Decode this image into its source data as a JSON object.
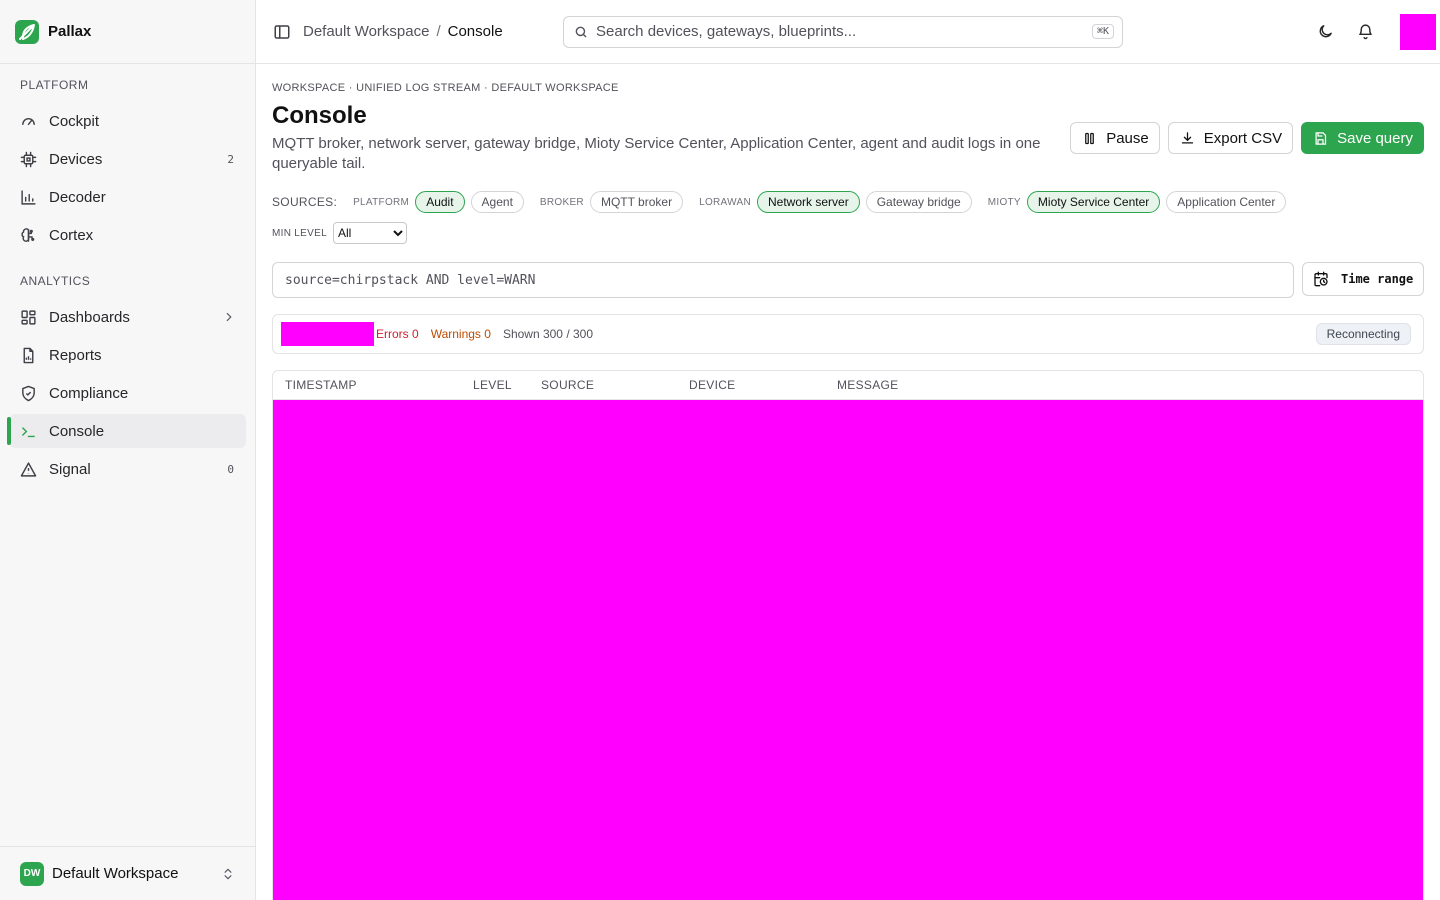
{
  "app": {
    "name": "Pallax"
  },
  "sidebar": {
    "sections": [
      {
        "label": "PLATFORM"
      },
      {
        "label": "ANALYTICS"
      }
    ],
    "items": [
      {
        "label": "Cockpit",
        "badge": ""
      },
      {
        "label": "Devices",
        "badge": "2"
      },
      {
        "label": "Decoder",
        "badge": ""
      },
      {
        "label": "Cortex",
        "badge": ""
      },
      {
        "label": "Dashboards",
        "badge": ""
      },
      {
        "label": "Reports",
        "badge": ""
      },
      {
        "label": "Compliance",
        "badge": ""
      },
      {
        "label": "Console",
        "badge": ""
      },
      {
        "label": "Signal",
        "badge": "0"
      }
    ],
    "active_item": "Console",
    "workspace": {
      "initials": "DW",
      "name": "Default Workspace"
    }
  },
  "header": {
    "breadcrumb": {
      "workspace": "Default Workspace",
      "separator": "/",
      "current": "Console"
    },
    "search": {
      "placeholder": "Search devices, gateways, blueprints...",
      "shortcut": "⌘K"
    }
  },
  "page": {
    "eyebrow": "WORKSPACE · UNIFIED LOG STREAM · DEFAULT WORKSPACE",
    "title": "Console",
    "description": "MQTT broker, network server, gateway bridge, Mioty Service Center, Application Center, agent and audit logs in one queryable tail.",
    "actions": {
      "pause": "Pause",
      "export": "Export CSV",
      "save": "Save query"
    }
  },
  "sources": {
    "label": "SOURCES:",
    "groups": [
      {
        "name": "PLATFORM",
        "chips": [
          {
            "label": "Audit",
            "on": true
          },
          {
            "label": "Agent",
            "on": false
          }
        ]
      },
      {
        "name": "BROKER",
        "chips": [
          {
            "label": "MQTT broker",
            "on": false
          }
        ]
      },
      {
        "name": "LORAWAN",
        "chips": [
          {
            "label": "Network server",
            "on": true
          },
          {
            "label": "Gateway bridge",
            "on": false
          }
        ]
      },
      {
        "name": "MIOTY",
        "chips": [
          {
            "label": "Mioty Service Center",
            "on": true
          },
          {
            "label": "Application Center",
            "on": false
          }
        ]
      }
    ]
  },
  "filters": {
    "min_level_label": "MIN LEVEL",
    "min_level_value": "All",
    "query_placeholder": "source=chirpstack AND level=WARN",
    "time_range_label": "Time range"
  },
  "status": {
    "errors": "Errors 0",
    "warnings": "Warnings 0",
    "shown": "Shown 300 / 300",
    "connection": "Reconnecting"
  },
  "table": {
    "columns": [
      "TIMESTAMP",
      "LEVEL",
      "SOURCE",
      "DEVICE",
      "MESSAGE"
    ]
  },
  "colors": {
    "accent": "#2da44e",
    "error": "#cf222e",
    "warning": "#bc4c00",
    "redacted": "#ff00ff"
  }
}
